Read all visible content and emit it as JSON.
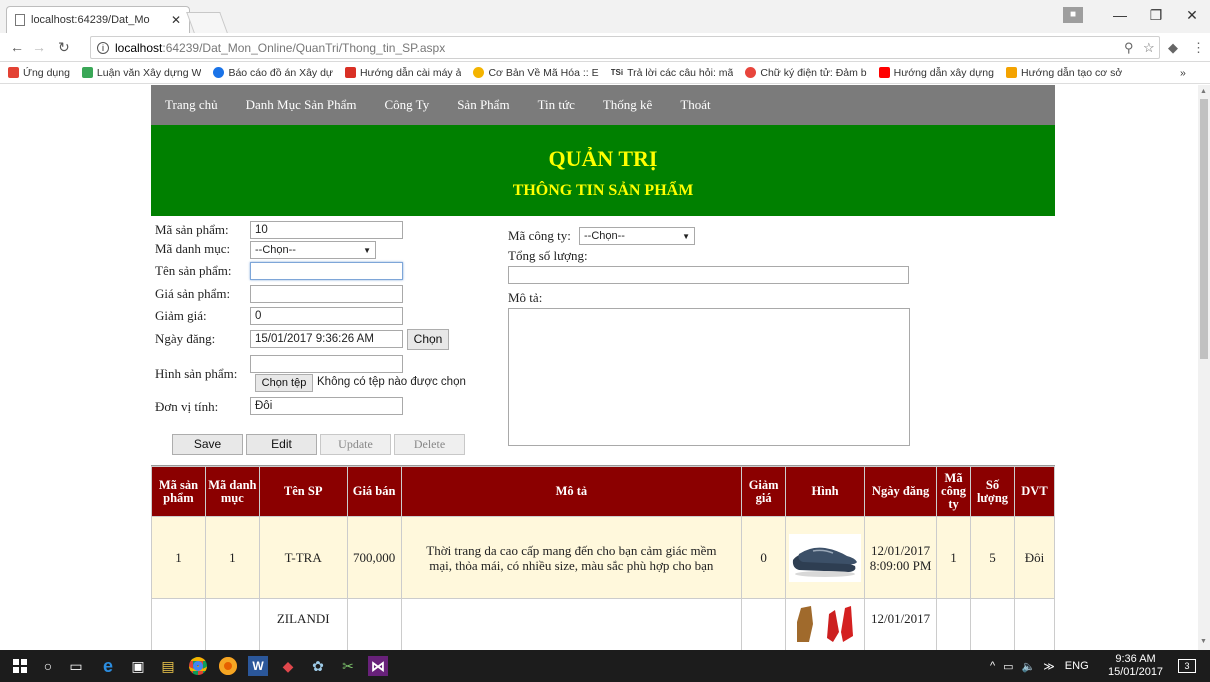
{
  "browser": {
    "tab_title": "localhost:64239/Dat_Mo",
    "url_host": "localhost",
    "url_path": ":64239/Dat_Mon_Online/QuanTri/Thong_tin_SP.aspx",
    "bookmarks": [
      {
        "label": "Ứng dụng",
        "color": "#e34234"
      },
      {
        "label": "Luận văn Xây dựng W",
        "color": "#3aa757"
      },
      {
        "label": "Báo cáo đồ án Xây dự",
        "color": "#1a73e8"
      },
      {
        "label": "Hướng dẫn cài máy ả",
        "color": "#d93025"
      },
      {
        "label": "Cơ Bản Về Mã Hóa :: E",
        "color": "#f4b400"
      },
      {
        "label": "Trả lời các câu hỏi: mã",
        "color": "#555555"
      },
      {
        "label": "Chữ ký điện tử: Đảm b",
        "color": "#e8453c"
      },
      {
        "label": "Hướng dẫn xây dựng",
        "color": "#ff0000"
      },
      {
        "label": "Hướng dẫn tạo cơ sở",
        "color": "#f4a300"
      }
    ],
    "tsi": "TSi",
    "more": "»"
  },
  "site": {
    "menu": [
      "Trang chủ",
      "Danh Mục Sản Phẩm",
      "Công Ty",
      "Sản Phẩm",
      "Tin tức",
      "Thống kê",
      "Thoát"
    ],
    "title": "QUẢN TRỊ",
    "subtitle": "THÔNG TIN SẢN PHẨM"
  },
  "form": {
    "ma_sp_label": "Mã sản phẩm:",
    "ma_sp_value": "10",
    "ma_dm_label": "Mã danh mục:",
    "ma_dm_value": "--Chọn--",
    "ten_sp_label": "Tên sản phẩm:",
    "ten_sp_value": "",
    "gia_label": "Giá sản phẩm:",
    "gia_value": "",
    "giam_gia_label": "Giảm giá:",
    "giam_gia_value": "0",
    "ngay_dang_label": "Ngày đăng:",
    "ngay_dang_value": "15/01/2017 9:36:26 AM",
    "chon_btn": "Chọn",
    "hinh_label": "Hình sản phẩm:",
    "hinh_value": "",
    "chon_tep_btn": "Chọn tệp",
    "no_file": "Không có tệp nào được chọn",
    "dvt_label": "Đơn vị tính:",
    "dvt_value": "Đôi",
    "save": "Save",
    "edit": "Edit",
    "update": "Update",
    "delete": "Delete",
    "ma_cty_label": "Mã công ty:",
    "ma_cty_value": "--Chọn--",
    "tong_sl_label": "Tổng số lượng:",
    "tong_sl_value": "",
    "mo_ta_label": "Mô tả:",
    "mo_ta_value": ""
  },
  "table": {
    "headers": [
      "Mã sản phẩm",
      "Mã danh mục",
      "Tên SP",
      "Giá bán",
      "Mô tả",
      "Giảm giá",
      "Hình",
      "Ngày đăng",
      "Mã công ty",
      "Số lượng",
      "DVT"
    ],
    "rows": [
      {
        "ma_sp": "1",
        "ma_dm": "1",
        "ten": "T-TRA",
        "gia": "700,000",
        "mota": "Thời trang da cao cấp mang đến cho bạn cảm giác mềm mại, thỏa mái, có nhiều size, màu sắc phù hợp cho bạn",
        "giam": "0",
        "ngay": "12/01/2017 8:09:00 PM",
        "cty": "1",
        "sl": "5",
        "dvt": "Đôi"
      },
      {
        "ma_sp": "",
        "ma_dm": "",
        "ten": "ZILANDI",
        "gia": "",
        "mota": "",
        "giam": "",
        "ngay": "12/01/2017",
        "cty": "",
        "sl": "",
        "dvt": ""
      }
    ]
  },
  "taskbar": {
    "time": "9:36 AM",
    "date": "15/01/2017",
    "lang": "ENG",
    "notif_count": "3"
  }
}
